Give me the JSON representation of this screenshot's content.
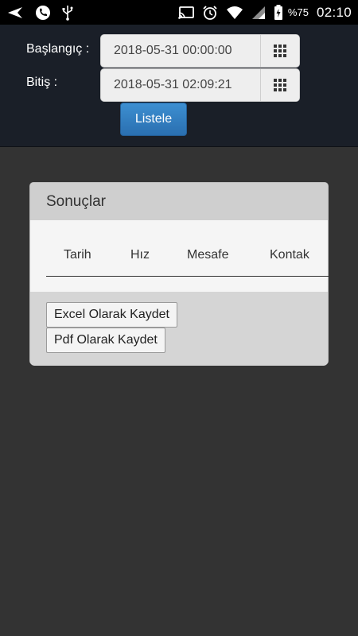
{
  "status_bar": {
    "battery": "%75",
    "time": "02:10",
    "icons": [
      "back-arrow-icon",
      "phone-icon",
      "usb-icon",
      "cast-icon",
      "alarm-icon",
      "wifi-icon",
      "signal-icon",
      "battery-icon"
    ]
  },
  "filter": {
    "start_label": "Başlangıç :",
    "start_value": "2018-05-31 00:00:00",
    "end_label": "Bitiş :",
    "end_value": "2018-05-31 02:09:21",
    "calendar_icon": "grid-calendar-icon",
    "list_button": "Listele",
    "accent_color": "#2f7cc0"
  },
  "results": {
    "title": "Sonuçlar",
    "columns": [
      "Tarih",
      "Hız",
      "Mesafe",
      "Kontak"
    ],
    "rows": [],
    "excel_button": "Excel Olarak Kaydet",
    "pdf_button": "Pdf Olarak Kaydet"
  }
}
